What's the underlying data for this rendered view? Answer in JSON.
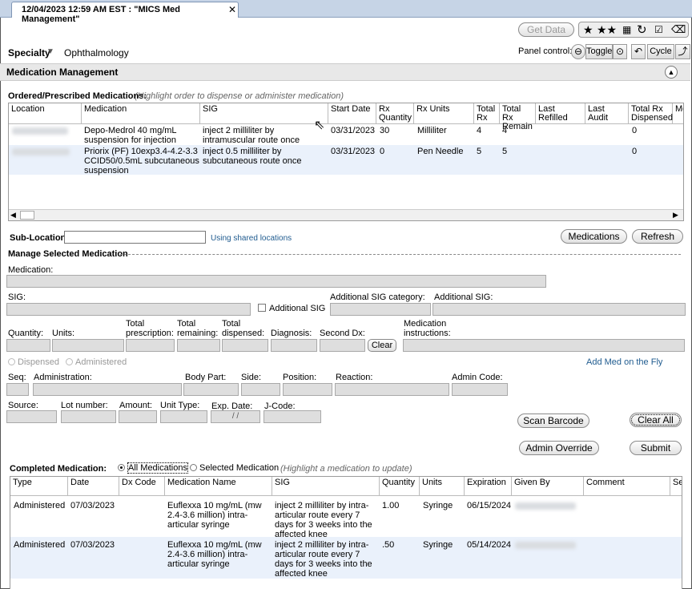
{
  "tab": {
    "title": "12/04/2023 12:59 AM EST : \"MICS Med Management\"",
    "close": "✕"
  },
  "toolbar": {
    "get_data": "Get Data",
    "specialty_label": "Specialty",
    "specialty_value": "Ophthalmology",
    "panel_control": "Panel control:",
    "toggle": "Toggle",
    "cycle": "Cycle"
  },
  "header": {
    "title": "Medication Management"
  },
  "ordered": {
    "label": "Ordered/Prescribed Medications:",
    "hint": "(Highlight order to dispense or administer medication)",
    "columns": [
      "Location",
      "Medication",
      "SIG",
      "Start Date",
      "Rx Quantity",
      "Rx Units",
      "Total Rx",
      "Total Rx Remain",
      "Last Refilled",
      "Last Audit",
      "Total Rx Dispensed",
      "Me"
    ],
    "rows": [
      {
        "medication": "Depo-Medrol 40 mg/mL suspension for injection",
        "sig": "inject 2 milliliter by intramuscular route once",
        "start": "03/31/2023",
        "qty": "30",
        "units": "Milliliter",
        "total": "4",
        "remain": "4",
        "dispensed": "0"
      },
      {
        "medication": "Priorix (PF) 10exp3.4-4.2-3.3 CCID50/0.5mL subcutaneous suspension",
        "sig": "inject 0.5 milliliter by subcutaneous route once",
        "start": "03/31/2023",
        "qty": "0",
        "units": "Pen Needle",
        "total": "5",
        "remain": "5",
        "dispensed": "0"
      }
    ]
  },
  "subloc": {
    "label": "Sub-Location:",
    "shared": "Using shared locations",
    "medications_btn": "Medications",
    "refresh_btn": "Refresh"
  },
  "manage": {
    "title": "Manage Selected Medication",
    "medication": "Medication:",
    "sig": "SIG:",
    "additional_sig": "Additional SIG",
    "additional_sig_category": "Additional SIG category:",
    "additional_sig2": "Additional SIG:",
    "quantity": "Quantity:",
    "units": "Units:",
    "total_prescription": "Total prescription:",
    "total_remaining": "Total remaining:",
    "total_dispensed": "Total dispensed:",
    "diagnosis": "Diagnosis:",
    "second_dx": "Second Dx:",
    "clear": "Clear",
    "med_instructions": "Medication instructions:",
    "dispensed": "Dispensed",
    "administered": "Administered",
    "add_med": "Add Med on the Fly",
    "seq": "Seq:",
    "administration": "Administration:",
    "body_part": "Body Part:",
    "side": "Side:",
    "position": "Position:",
    "reaction": "Reaction:",
    "admin_code": "Admin Code:",
    "source": "Source:",
    "lot": "Lot number:",
    "amount": "Amount:",
    "unit_type": "Unit Type:",
    "exp_date": "Exp. Date:",
    "exp_value": "/ /",
    "jcode": "J-Code:",
    "scan": "Scan Barcode",
    "clear_all": "Clear All",
    "override": "Admin Override",
    "submit": "Submit"
  },
  "completed": {
    "label": "Completed Medication:",
    "all": "All Medications",
    "selected": "Selected Medication",
    "hint": "(Highlight a medication to update)",
    "columns": [
      "Type",
      "Date",
      "Dx Code",
      "Medication Name",
      "SIG",
      "Quantity",
      "Units",
      "Expiration",
      "Given By",
      "Comment",
      "Se"
    ],
    "rows": [
      {
        "type": "Administered",
        "date": "07/03/2023",
        "name": "Euflexxa 10 mg/mL (mw 2.4-3.6 million) intra-articular syringe",
        "sig": "inject 2 milliliter by intra-articular route  every 7 days for 3 weeks into the affected knee",
        "qty": "1.00",
        "units": "Syringe",
        "exp": "06/15/2024"
      },
      {
        "type": "Administered",
        "date": "07/03/2023",
        "name": "Euflexxa 10 mg/mL (mw 2.4-3.6 million) intra-articular syringe",
        "sig": "inject 2 milliliter by intra-articular route  every 7 days for 3 weeks into the affected knee",
        "qty": ".50",
        "units": "Syringe",
        "exp": "05/14/2024"
      }
    ]
  }
}
